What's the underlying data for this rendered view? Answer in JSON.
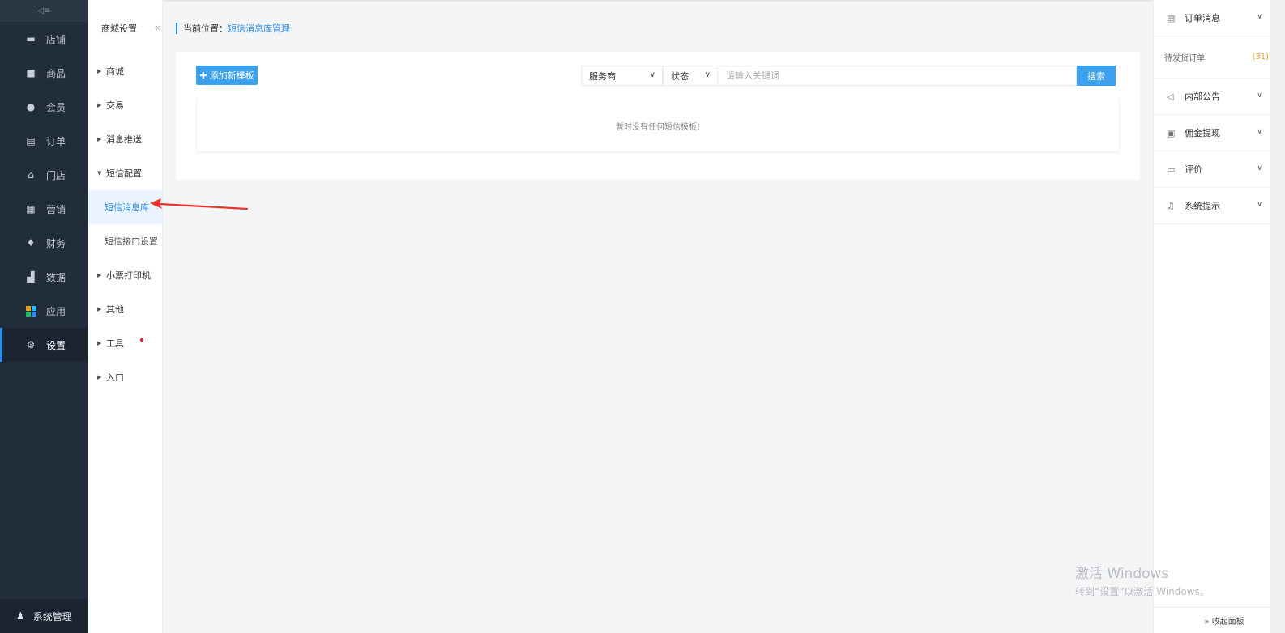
{
  "nav": {
    "collapse_label": "◁≡",
    "items": [
      {
        "label": "店铺",
        "icon": "store-icon"
      },
      {
        "label": "商品",
        "icon": "goods-icon"
      },
      {
        "label": "会员",
        "icon": "member-icon"
      },
      {
        "label": "订单",
        "icon": "order-icon"
      },
      {
        "label": "门店",
        "icon": "shop-icon"
      },
      {
        "label": "营销",
        "icon": "gift-icon"
      },
      {
        "label": "财务",
        "icon": "money-bag-icon"
      },
      {
        "label": "数据",
        "icon": "chart-icon"
      },
      {
        "label": "应用",
        "icon": "apps-icon"
      },
      {
        "label": "设置",
        "icon": "gear-icon"
      }
    ],
    "bottom_label": "系统管理"
  },
  "sub": {
    "title": "商城设置",
    "groups": [
      {
        "label": "商城"
      },
      {
        "label": "交易"
      },
      {
        "label": "消息推送"
      },
      {
        "label": "短信配置"
      }
    ],
    "leaves": [
      {
        "label": "短信消息库"
      },
      {
        "label": "短信接口设置"
      }
    ],
    "groups2": [
      {
        "label": "小票打印机"
      },
      {
        "label": "其他"
      },
      {
        "label": "工具"
      },
      {
        "label": "入口"
      }
    ]
  },
  "crumb": {
    "prefix": "当前位置：",
    "current": "短信消息库管理"
  },
  "toolbar": {
    "add_label": "添加新模板",
    "provider_value": "服务商",
    "status_value": "状态",
    "keyword_placeholder": "请输入关键词",
    "search_label": "搜索"
  },
  "table": {
    "empty_text": "暂时没有任何短信模板!"
  },
  "right": {
    "sections": [
      {
        "label": "订单消息"
      },
      {
        "label": "内部公告"
      },
      {
        "label": "佣金提现"
      },
      {
        "label": "评价"
      },
      {
        "label": "系统提示"
      }
    ],
    "pending": {
      "label": "待发货订单",
      "count": "(31)"
    },
    "footer_label": "» 收起面板"
  },
  "watermark": {
    "line1": "激活 Windows",
    "line2": "转到“设置”以激活 Windows。"
  },
  "colors": {
    "accent": "#3aa1ee",
    "nav_bg": "#222d3c",
    "arrow": "#e8332a"
  }
}
